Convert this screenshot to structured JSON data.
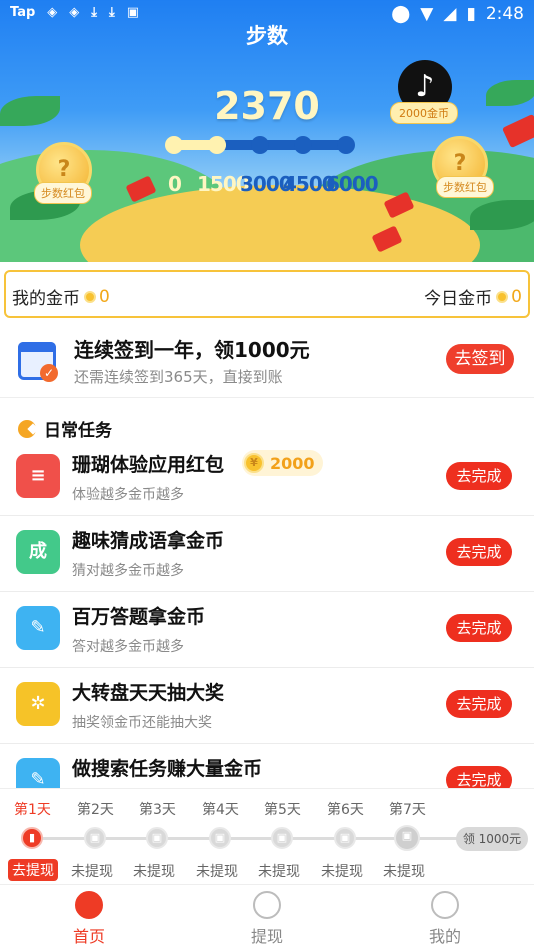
{
  "status_bar": {
    "left_icons": [
      "tap-icon",
      "sync-icon",
      "sync-icon",
      "download-icon",
      "download-icon",
      "news-icon"
    ],
    "tap_text": "Tap",
    "time": "2:48"
  },
  "header": {
    "title": "步数"
  },
  "hero": {
    "steps": "2370",
    "milestones": [
      "0",
      "1500",
      "3000",
      "4500",
      "6000"
    ],
    "milestones_reached": 2,
    "left_coin_label": "步数红包",
    "right_coin_label": "步数红包",
    "coin_glyph": "?",
    "tiktok_label": "2000金币",
    "tiktok_glyph": "♪"
  },
  "coins": {
    "my_label": "我的金币",
    "my_value": "0",
    "today_label": "今日金币",
    "today_value": "0"
  },
  "checkin": {
    "title": "连续签到一年，领1000元",
    "subtitle": "还需连续签到365天，直接到账",
    "button": "去签到"
  },
  "daily": {
    "heading": "日常任务",
    "tasks": [
      {
        "title": "珊瑚体验应用红包",
        "subtitle": "体验越多金币越多",
        "button": "去完成",
        "reward": "2000",
        "icon": "red-envelope-icon",
        "icon_glyph": "≡",
        "color": "#f0504a"
      },
      {
        "title": "趣味猜成语拿金币",
        "subtitle": "猜对越多金币越多",
        "button": "去完成",
        "icon": "idiom-book-icon",
        "icon_glyph": "成",
        "color": "#43c98a"
      },
      {
        "title": "百万答题拿金币",
        "subtitle": "答对越多金币越多",
        "button": "去完成",
        "icon": "quiz-pencil-icon",
        "icon_glyph": "✎",
        "color": "#3eb3f2"
      },
      {
        "title": "大转盘天天抽大奖",
        "subtitle": "抽奖领金币还能抽大奖",
        "button": "去完成",
        "icon": "lucky-wheel-icon",
        "icon_glyph": "✲",
        "color": "#f6c328"
      },
      {
        "title": "做搜索任务赚大量金币",
        "subtitle": "",
        "button": "去完成",
        "icon": "search-task-icon",
        "icon_glyph": "✎",
        "color": "#3eb3f2"
      }
    ]
  },
  "withdraw_strip": {
    "days": [
      "第1天",
      "第2天",
      "第3天",
      "第4天",
      "第5天",
      "第6天",
      "第7天"
    ],
    "statuses": [
      "去提现",
      "未提现",
      "未提现",
      "未提现",
      "未提现",
      "未提现",
      "未提现"
    ],
    "bonus": "领 1000元",
    "lock_glyph": "🔒"
  },
  "nav": {
    "items": [
      {
        "label": "首页",
        "icon": "home-icon"
      },
      {
        "label": "提现",
        "icon": "money-bag-icon"
      },
      {
        "label": "我的",
        "icon": "profile-icon"
      }
    ]
  },
  "colors": {
    "accent": "#ee3b25",
    "hero_blue": "#1f7ff2",
    "gold": "#f2a81a"
  }
}
